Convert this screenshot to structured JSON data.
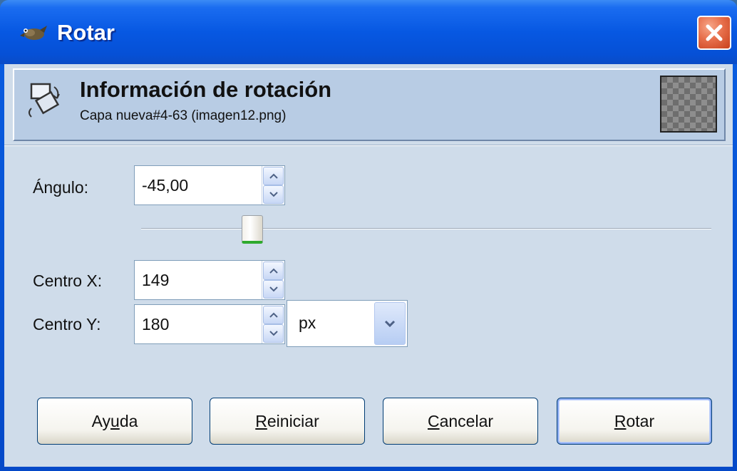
{
  "window": {
    "title": "Rotar",
    "icon": "gimp-wilber-icon"
  },
  "header": {
    "icon": "rotate-tool-icon",
    "title": "Información de rotación",
    "subtitle": "Capa nueva#4-63 (imagen12.png)"
  },
  "form": {
    "angle_label": "Ángulo:",
    "angle_value": "-45,00",
    "angle_slider_value": -45,
    "angle_slider_range": [
      -180,
      180
    ],
    "center_x_label": "Centro X:",
    "center_x_value": "149",
    "center_y_label": "Centro Y:",
    "center_y_value": "180",
    "unit_value": "px"
  },
  "buttons": {
    "help": {
      "pre": "Ay",
      "mn": "u",
      "post": "da"
    },
    "reset": {
      "pre": "",
      "mn": "R",
      "post": "einiciar"
    },
    "cancel": {
      "pre": "",
      "mn": "C",
      "post": "ancelar"
    },
    "rotate": {
      "pre": "",
      "mn": "R",
      "post": "otar"
    }
  },
  "colors": {
    "titlebar": "#0758e2",
    "close": "#e76f4b",
    "dialog_bg": "#cfdcea",
    "slider_accent": "#2eaa2e"
  }
}
